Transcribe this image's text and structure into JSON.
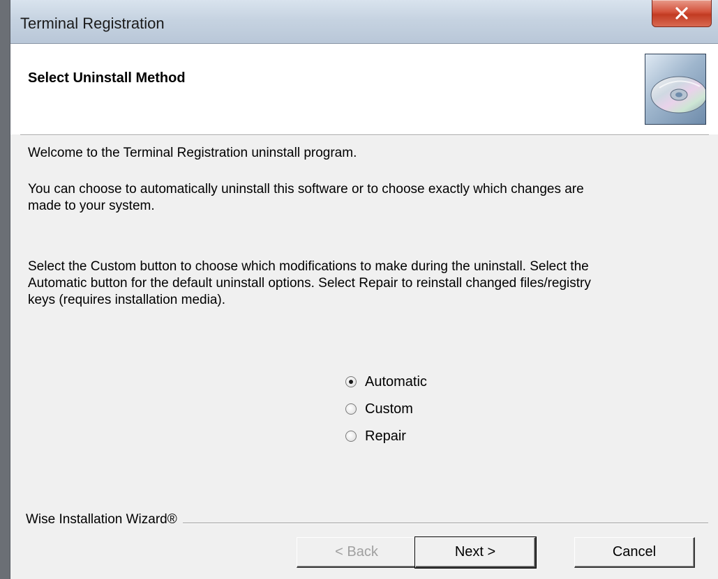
{
  "window": {
    "title": "Terminal Registration"
  },
  "header": {
    "title": "Select Uninstall Method",
    "icon": "cd-disc-icon"
  },
  "body": {
    "welcome": "Welcome to the Terminal Registration uninstall program.",
    "intro_line1": "You can choose to automatically uninstall this software or to choose exactly which changes are",
    "intro_line2": "made to your system.",
    "instr_line1": "Select the Custom button to choose which modifications to make during the uninstall. Select the",
    "instr_line2": "Automatic button for the default uninstall options. Select Repair to reinstall changed files/registry",
    "instr_line3": "keys (requires installation media)."
  },
  "options": [
    {
      "label": "Automatic",
      "checked": true
    },
    {
      "label": "Custom",
      "checked": false
    },
    {
      "label": "Repair",
      "checked": false
    }
  ],
  "footer": {
    "wizard_label": "Wise Installation Wizard®"
  },
  "buttons": {
    "back": "< Back",
    "next": "Next >",
    "cancel": "Cancel"
  },
  "colors": {
    "close_button": "#c23b22",
    "dialog_bg": "#f0f0f0",
    "header_bg": "#ffffff"
  }
}
